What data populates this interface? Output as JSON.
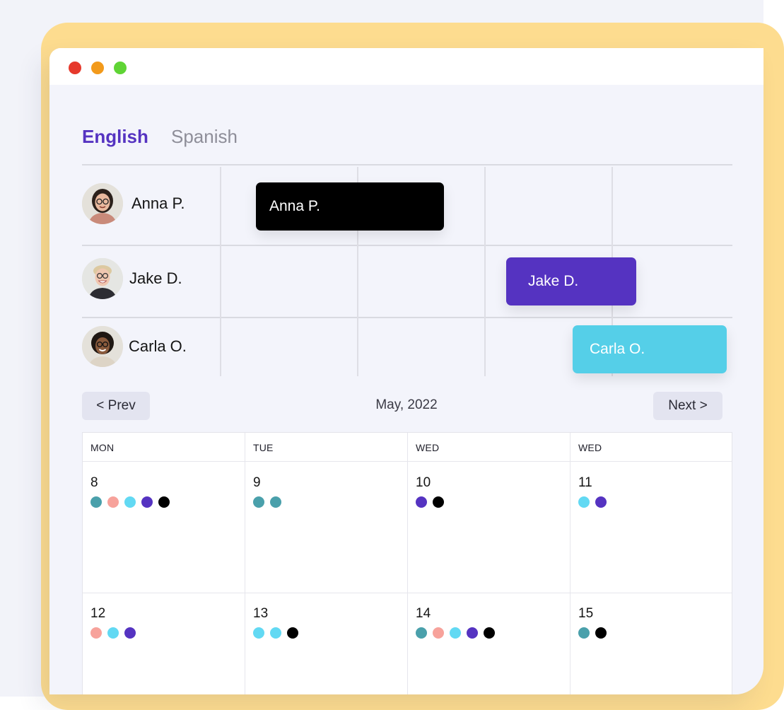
{
  "window": {
    "controls": [
      {
        "name": "close",
        "color": "#e6392c"
      },
      {
        "name": "minimize",
        "color": "#f29a1b"
      },
      {
        "name": "maximize",
        "color": "#5fd435"
      }
    ]
  },
  "tabs": [
    {
      "label": "English",
      "active": true,
      "color": "#5533c1"
    },
    {
      "label": "Spanish",
      "active": false,
      "color": "#8e8e99"
    }
  ],
  "schedule": {
    "people": [
      {
        "name": "Anna P.",
        "avatar_icon": "woman-glasses-avatar"
      },
      {
        "name": "Jake D.",
        "avatar_icon": "man-blond-avatar"
      },
      {
        "name": "Carla O.",
        "avatar_icon": "woman-curly-avatar"
      }
    ],
    "bars": [
      {
        "label": "Anna P.",
        "color": "#000000"
      },
      {
        "label": "Jake D.",
        "color": "#5533c1"
      },
      {
        "label": "Carla O.",
        "color": "#55cfe8"
      }
    ]
  },
  "nav": {
    "prev_label": "< Prev",
    "month": "May, 2022",
    "next_label": "Next >"
  },
  "calendar": {
    "day_names": [
      "MON",
      "TUE",
      "WED",
      "WED"
    ],
    "event_colors": {
      "teal": "#4aa0ab",
      "pink": "#f7a29b",
      "cyan": "#62d9f3",
      "purple": "#5533c1",
      "black": "#000000"
    },
    "weeks": [
      [
        {
          "date": "8",
          "events": [
            "teal",
            "pink",
            "cyan",
            "purple",
            "black"
          ]
        },
        {
          "date": "9",
          "events": [
            "teal",
            "teal"
          ]
        },
        {
          "date": "10",
          "events": [
            "purple",
            "black"
          ]
        },
        {
          "date": "11",
          "events": [
            "cyan",
            "purple"
          ]
        }
      ],
      [
        {
          "date": "12",
          "events": [
            "pink",
            "cyan",
            "purple"
          ]
        },
        {
          "date": "13",
          "events": [
            "cyan",
            "cyan",
            "black"
          ]
        },
        {
          "date": "14",
          "events": [
            "teal",
            "pink",
            "cyan",
            "purple",
            "black"
          ]
        },
        {
          "date": "15",
          "events": [
            "teal",
            "black"
          ]
        }
      ]
    ]
  }
}
